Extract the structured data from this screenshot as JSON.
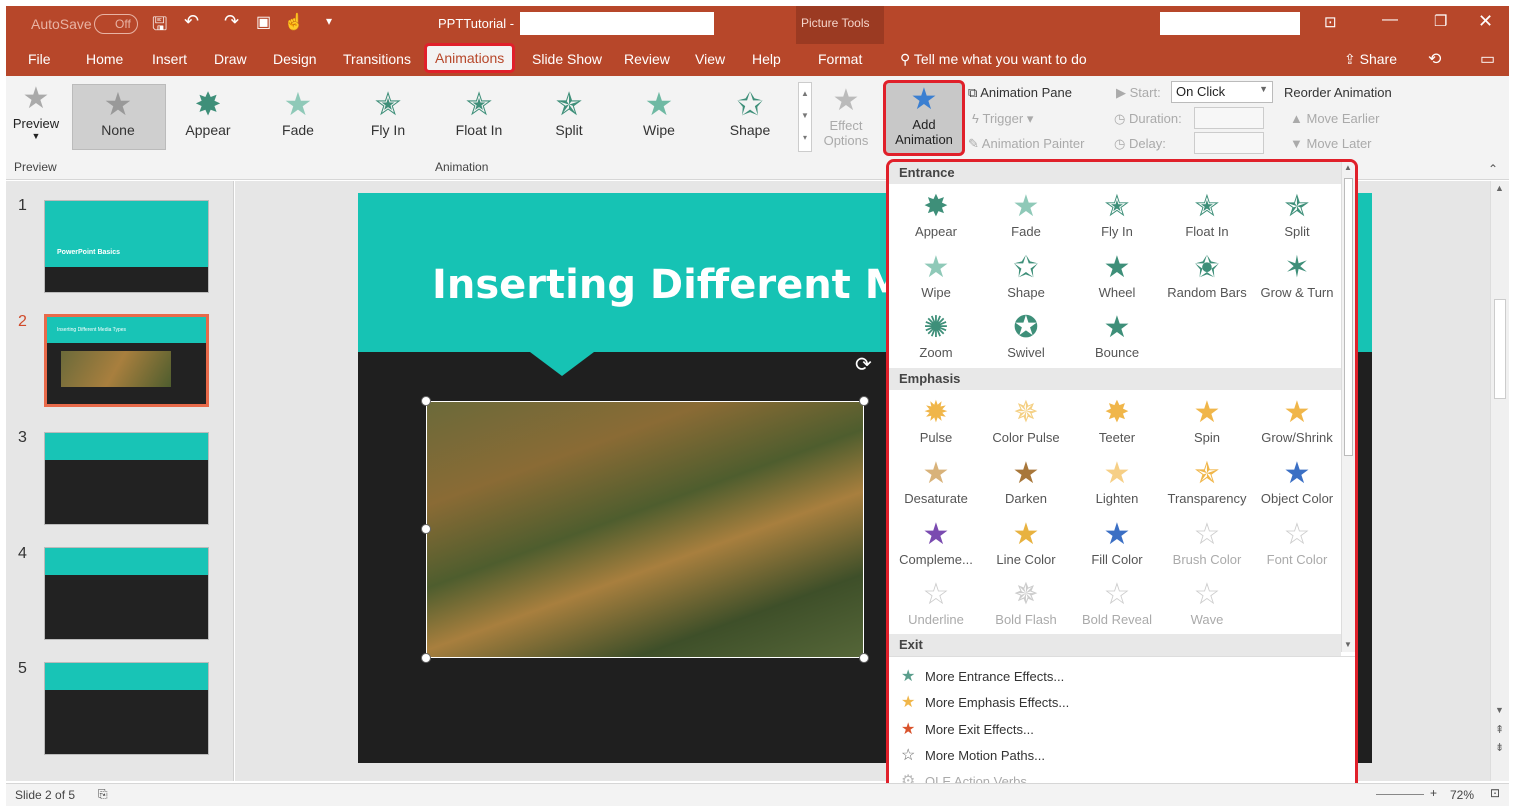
{
  "titlebar": {
    "autosave": "AutoSave",
    "autosave_state": "Off",
    "file_title": "PPTTutorial -",
    "picture_tools": "Picture Tools"
  },
  "tabs": [
    "File",
    "Home",
    "Insert",
    "Draw",
    "Design",
    "Transitions",
    "Animations",
    "Slide Show",
    "Review",
    "View",
    "Help",
    "Format"
  ],
  "tell_me": "Tell me what you want to do",
  "share": "Share",
  "ribbon": {
    "preview_label": "Preview",
    "preview_group": "Preview",
    "animation_group": "Animation",
    "gallery": [
      "None",
      "Appear",
      "Fade",
      "Fly In",
      "Float In",
      "Split",
      "Wipe",
      "Shape"
    ],
    "effect_options": [
      "Effect",
      "Options"
    ],
    "add_animation": [
      "Add",
      "Animation"
    ],
    "animation_pane": "Animation Pane",
    "trigger": "Trigger",
    "animation_painter": "Animation Painter",
    "start_label": "Start:",
    "start_value": "On Click",
    "duration_label": "Duration:",
    "delay_label": "Delay:",
    "reorder": "Reorder Animation",
    "move_earlier": "Move Earlier",
    "move_later": "Move Later"
  },
  "slides": [
    "1",
    "2",
    "3",
    "4",
    "5"
  ],
  "slide_thumb_titles": {
    "s1": "PowerPoint Basics",
    "s2": "Inserting Different Media Types"
  },
  "slide": {
    "title": "Inserting Different Med"
  },
  "dropdown": {
    "entrance_label": "Entrance",
    "entrance": [
      "Appear",
      "Fade",
      "Fly In",
      "Float In",
      "Split",
      "Wipe",
      "Shape",
      "Wheel",
      "Random Bars",
      "Grow & Turn",
      "Zoom",
      "Swivel",
      "Bounce"
    ],
    "emphasis_label": "Emphasis",
    "emphasis": [
      "Pulse",
      "Color Pulse",
      "Teeter",
      "Spin",
      "Grow/Shrink",
      "Desaturate",
      "Darken",
      "Lighten",
      "Transparency",
      "Object Color",
      "Compleme...",
      "Line Color",
      "Fill Color",
      "Brush Color",
      "Font Color",
      "Underline",
      "Bold Flash",
      "Bold Reveal",
      "Wave"
    ],
    "exit_label": "Exit",
    "more": [
      "More Entrance Effects...",
      "More Emphasis Effects...",
      "More Exit Effects...",
      "More Motion Paths...",
      "OLE Action Verbs..."
    ]
  },
  "statusbar": {
    "slide_info": "Slide 2 of 5",
    "zoom": "72%"
  },
  "colors": {
    "accent": "#b7472a",
    "teal": "#16c3b4",
    "highlight": "#e0202a",
    "entrance_star": "#5a9e8c",
    "emphasis_star": "#f0b64a",
    "exit_star": "#d9532c"
  }
}
